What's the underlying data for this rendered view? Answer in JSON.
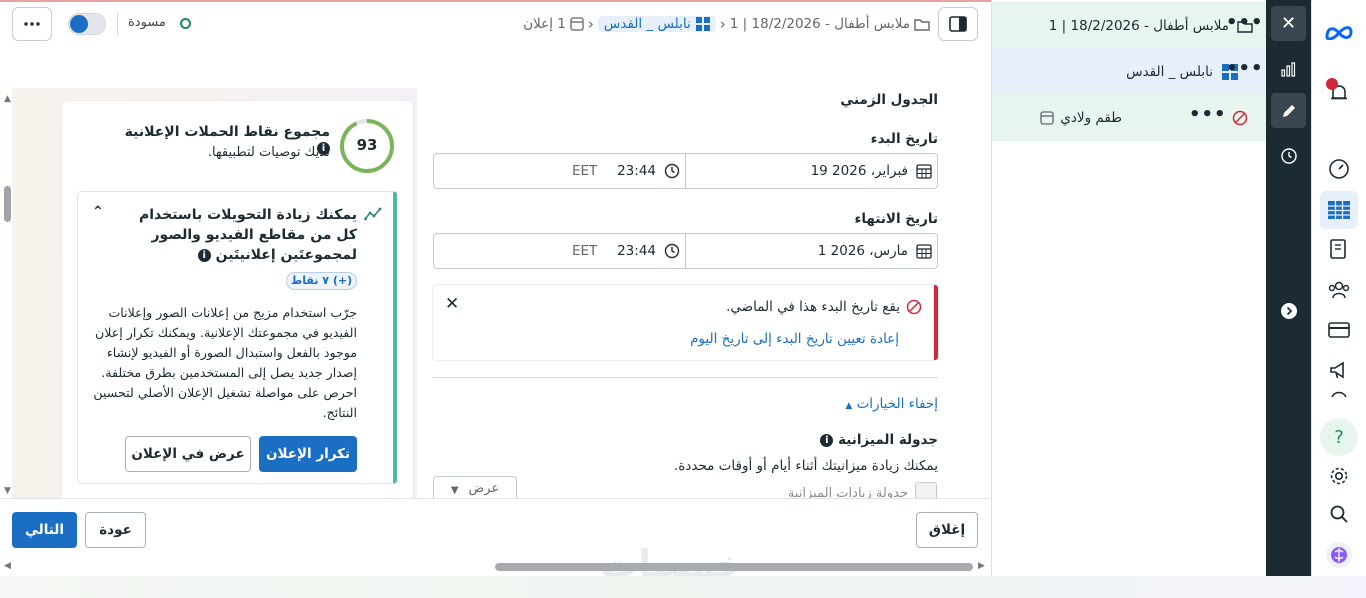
{
  "topbar": {
    "draft_label": "مسودة",
    "breadcrumb": {
      "campaign": "ملابس أطفال - 18/2/2026 | 1",
      "adset": "نابلس _ القدس",
      "ad_count": "1 إعلان"
    }
  },
  "score": {
    "value": "93",
    "title": "مجموع نقاط الحملات الإعلانية",
    "subtitle": "لديك توصيات لتطبيقها."
  },
  "recommendation": {
    "heading": "يمكنك زيادة التحويلات باستخدام كل من مقاطع الفيديو والصور لمجموعتَين إعلانيتَين",
    "badge": "(+) ٧ نقاط",
    "body": "جرّب استخدام مزيج من إعلانات الصور وإعلانات الفيديو في مجموعتك الإعلانية. ويمكنك تكرار إعلان موجود بالفعل واستبدال الصورة أو الفيديو لإنشاء إصدار جديد يصل إلى المستخدمين بطرق مختلفة. احرص على مواصلة تشغيل الإعلان الأصلي لتحسين النتائج.",
    "duplicate_label": "تكرار الإعلان",
    "view_label": "عرض في الإعلان"
  },
  "schedule": {
    "title": "الجدول الزمني",
    "start_label": "تاريخ البدء",
    "start_date": "19 فبراير، 2026",
    "start_time": "23:44",
    "start_tz": "EET",
    "end_label": "تاريخ الانتهاء",
    "end_date": "1 مارس، 2026",
    "end_time": "23:44",
    "end_tz": "EET"
  },
  "alert": {
    "message": "يقع تاريخ البدء هذا في الماضي.",
    "action": "إعادة تعيين تاريخ البدء إلى تاريخ اليوم"
  },
  "options": {
    "hide_label": "إخفاء الخيارات",
    "budget_title": "جدولة الميزانية",
    "budget_desc": "يمكنك زيادة ميزانيتك أثناء أيام أو أوقات محددة.",
    "budget_checkbox": "جدولة زيادات الميزانية",
    "view_select": "عرض"
  },
  "footer": {
    "close_label": "إغلاق",
    "back_label": "عودة",
    "next_label": "التالي"
  },
  "tree": {
    "campaign": "ملابس أطفال - 18/2/2026 | 1",
    "adset": "نابلس _ القدس",
    "ad": "طقم ولادي"
  },
  "watermark": "خمسات",
  "colors": {
    "accent": "#1a6fc4",
    "rail": "#1c2b33",
    "alert": "#d2283b",
    "success": "#4fb8a6"
  }
}
